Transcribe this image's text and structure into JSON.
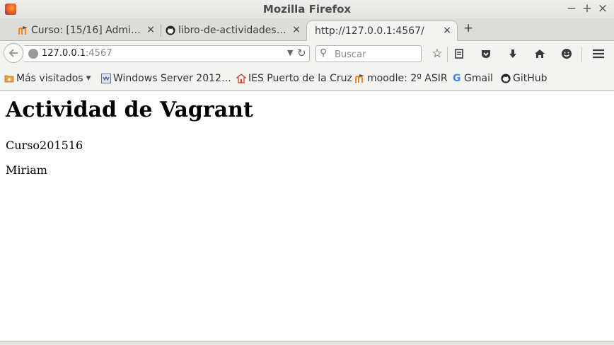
{
  "window": {
    "title": "Mozilla Firefox",
    "minimize_glyph": "−",
    "maximize_glyph": "+",
    "close_glyph": "×"
  },
  "tabs": [
    {
      "label": "Curso: [15/16] Admi…",
      "favicon": "moodle-icon",
      "active": false
    },
    {
      "label": "libro-de-actividades…",
      "favicon": "github-icon",
      "active": false
    },
    {
      "label": "http://127.0.0.1:4567/",
      "favicon": "",
      "active": true
    }
  ],
  "tab_close_glyph": "×",
  "new_tab_glyph": "+",
  "url": {
    "host": "127.0.0.1",
    "port": ":4567"
  },
  "search": {
    "placeholder": "Buscar"
  },
  "bookmarks": [
    {
      "label": "Más visitados",
      "icon": "folder-icon",
      "dropdown": true
    },
    {
      "label": "Windows Server 2012…",
      "icon": "windows-server-icon"
    },
    {
      "label": "IES Puerto de la Cruz",
      "icon": "school-icon"
    },
    {
      "label": "moodle: 2º ASIR",
      "icon": "moodle-icon"
    },
    {
      "label": "Gmail",
      "icon": "google-icon"
    },
    {
      "label": "GitHub",
      "icon": "github-icon"
    }
  ],
  "page": {
    "heading": "Actividad de Vagrant",
    "lines": [
      "Curso201516",
      "Miriam"
    ]
  },
  "colors": {
    "chrome_bg": "#f3f3f1",
    "tabstrip_bg": "#dcdcd9",
    "google_blue": "#4285f4",
    "moodle_orange": "#f98012"
  }
}
